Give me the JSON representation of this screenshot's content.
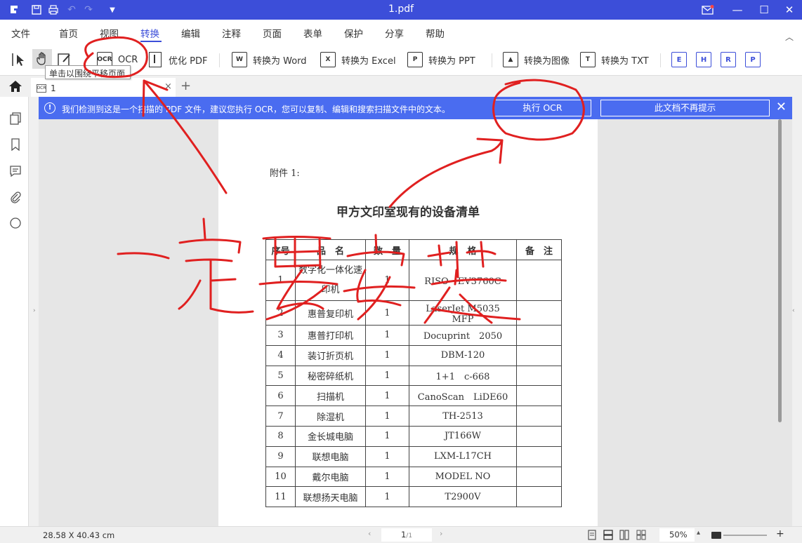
{
  "titlebar": {
    "title": "1.pdf",
    "accent": "#3c4ed9"
  },
  "menu": [
    "文件",
    "首页",
    "视图",
    "转换",
    "编辑",
    "注释",
    "页面",
    "表单",
    "保护",
    "分享",
    "帮助"
  ],
  "menu_active": "转换",
  "toolbar": {
    "ocr_label": "OCR",
    "optimize_label": "优化 PDF",
    "to_word": "转换为 Word",
    "to_excel": "转换为 Excel",
    "to_ppt": "转换为 PPT",
    "to_image": "转换为图像",
    "to_txt": "转换为 TXT",
    "ocr_icon_text": "OCR",
    "format_icons": [
      "E",
      "H",
      "R",
      "P"
    ]
  },
  "tooltip": "单击以围绕平移页面",
  "tab": {
    "label": "1"
  },
  "notice": {
    "message": "我们检测到这是一个扫描的 PDF 文件，建议您执行 OCR，您可以复制、编辑和搜索扫描文件中的文本。",
    "run_ocr": "执行 OCR",
    "dont_remind": "此文档不再提示",
    "color": "#4a6cf0"
  },
  "document": {
    "attachment": "附件 1:",
    "heading": "甲方文印室现有的设备清单",
    "columns": [
      "序号",
      "品　名",
      "数　量",
      "规　格",
      "备　注"
    ],
    "rows": [
      [
        "1",
        "数字化一体化速印机",
        "1",
        "RISO　EV3760C",
        ""
      ],
      [
        "2",
        "惠普复印机",
        "1",
        "LaserJet M5035　MFP",
        ""
      ],
      [
        "3",
        "惠普打印机",
        "1",
        "Docuprint　2050",
        ""
      ],
      [
        "4",
        "装订折页机",
        "1",
        "DBM-120",
        ""
      ],
      [
        "5",
        "秘密碎纸机",
        "1",
        "1+1　c-668",
        ""
      ],
      [
        "6",
        "扫描机",
        "1",
        "CanoScan　LiDE60",
        ""
      ],
      [
        "7",
        "除湿机",
        "1",
        "TH-2513",
        ""
      ],
      [
        "8",
        "金长城电脑",
        "1",
        "JT166W",
        ""
      ],
      [
        "9",
        "联想电脑",
        "1",
        "LXM-L17CH",
        ""
      ],
      [
        "10",
        "戴尔电脑",
        "1",
        "MODEL NO",
        ""
      ],
      [
        "11",
        "联想扬天电脑",
        "1",
        "T2900V",
        ""
      ]
    ]
  },
  "status": {
    "dimensions": "28.58 X 40.43 cm",
    "page_current": "1",
    "page_total": "/1",
    "zoom": "50%"
  },
  "annotation": {
    "handwriting": "一定要安装",
    "color": "#e02020"
  }
}
